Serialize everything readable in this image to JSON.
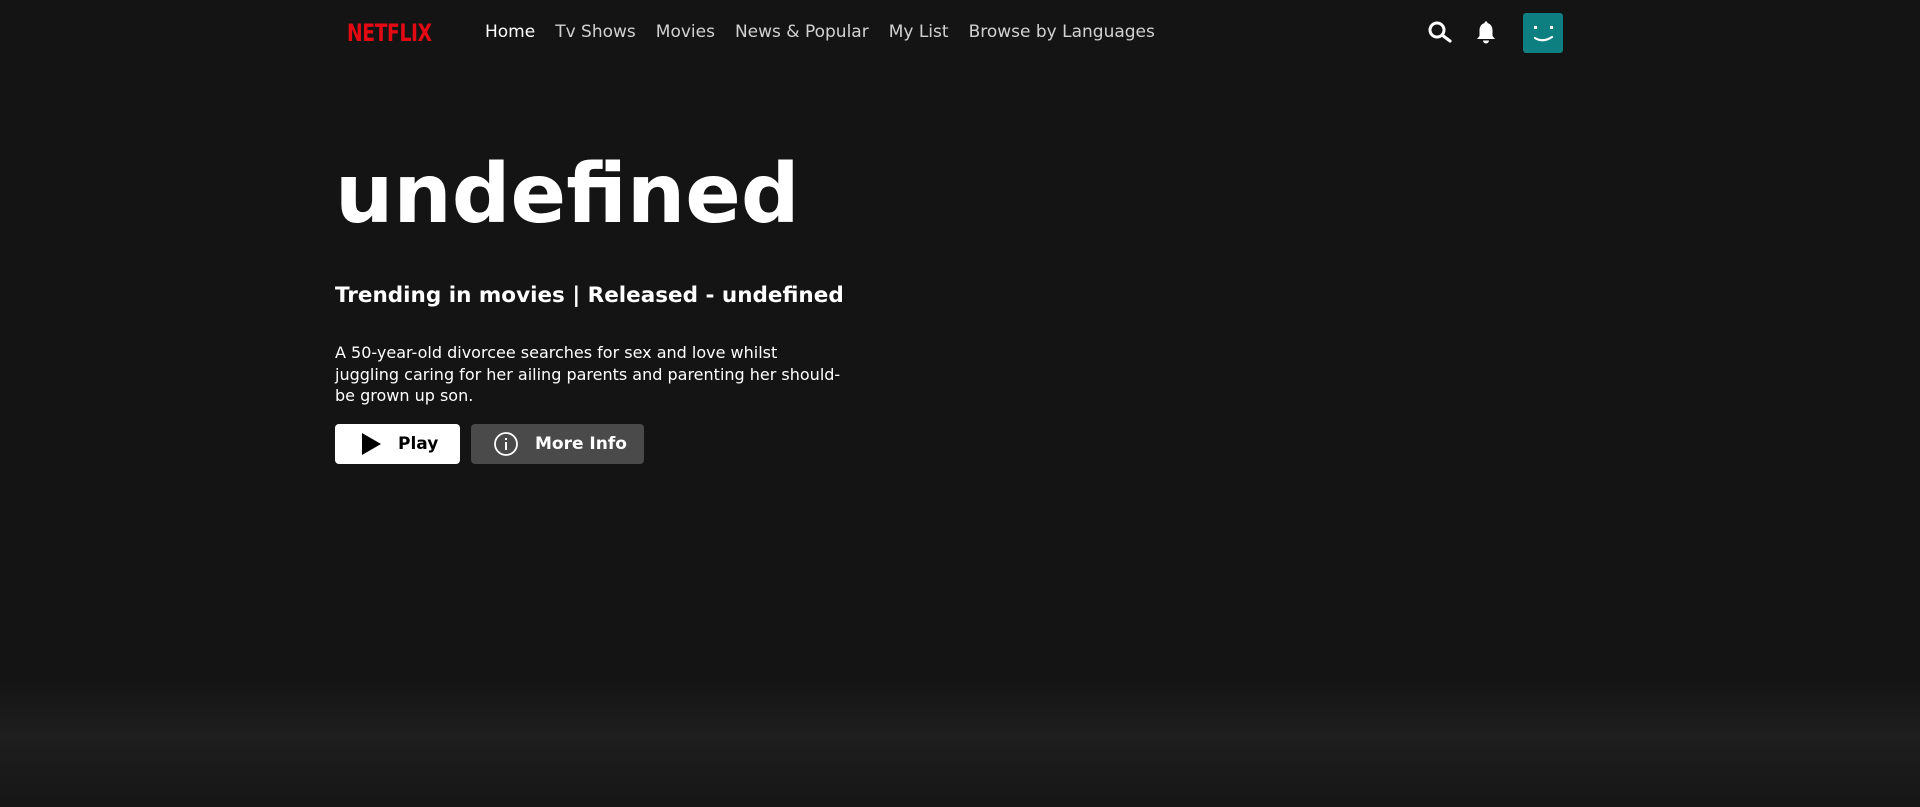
{
  "brand": {
    "logo_text": "NETFLIX",
    "color": "#e50914"
  },
  "nav": {
    "items": [
      {
        "label": "Home",
        "active": true
      },
      {
        "label": "Tv Shows",
        "active": false
      },
      {
        "label": "Movies",
        "active": false
      },
      {
        "label": "News & Popular",
        "active": false
      },
      {
        "label": "My List",
        "active": false
      },
      {
        "label": "Browse by Languages",
        "active": false
      }
    ],
    "icons": {
      "search": "search-icon",
      "notifications": "bell-icon",
      "profile": "avatar-smile-icon"
    },
    "avatar_color": "#0d7f80"
  },
  "hero": {
    "title": "undefined",
    "subtitle": "Trending in movies | Released - undefined",
    "description": "A 50-year-old divorcee searches for sex and love whilst juggling caring for her ailing parents and parenting her should-be grown up son.",
    "play_label": "Play",
    "more_info_label": "More Info"
  }
}
